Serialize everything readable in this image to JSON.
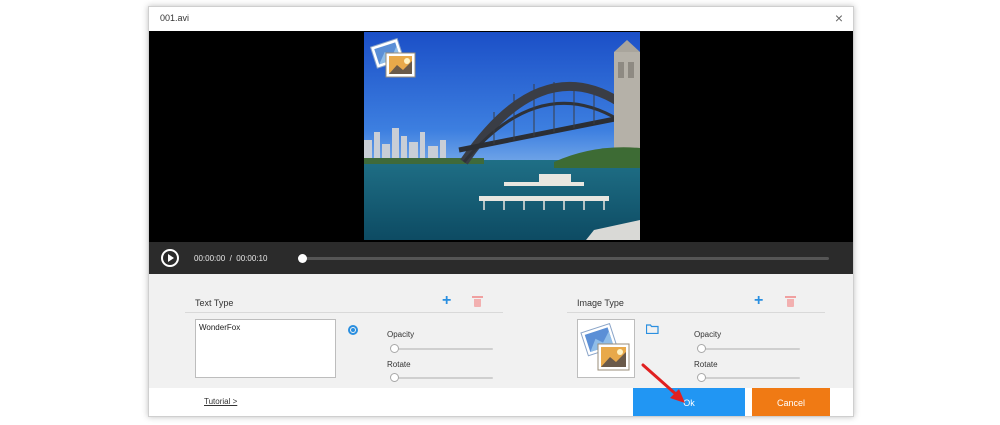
{
  "window": {
    "title": "001.avi",
    "close_glyph": "×"
  },
  "player": {
    "current_time": "00:00:00",
    "separator": "/",
    "total_time": "00:00:10",
    "progress": 0
  },
  "text_panel": {
    "header": "Text Type",
    "text_value": "WonderFox",
    "opacity_label": "Opacity",
    "opacity_value": 0,
    "rotate_label": "Rotate",
    "rotate_value": 0,
    "settings_icon": "gear-icon"
  },
  "image_panel": {
    "header": "Image Type",
    "opacity_label": "Opacity",
    "opacity_value": 0,
    "rotate_label": "Rotate",
    "rotate_value": 0,
    "folder_icon": "folder-icon"
  },
  "footer": {
    "tutorial": "Tutorial >",
    "ok": "Ok",
    "cancel": "Cancel"
  },
  "colors": {
    "accent": "#2196f3",
    "cancel": "#f07a14",
    "arrow": "#e02020"
  }
}
